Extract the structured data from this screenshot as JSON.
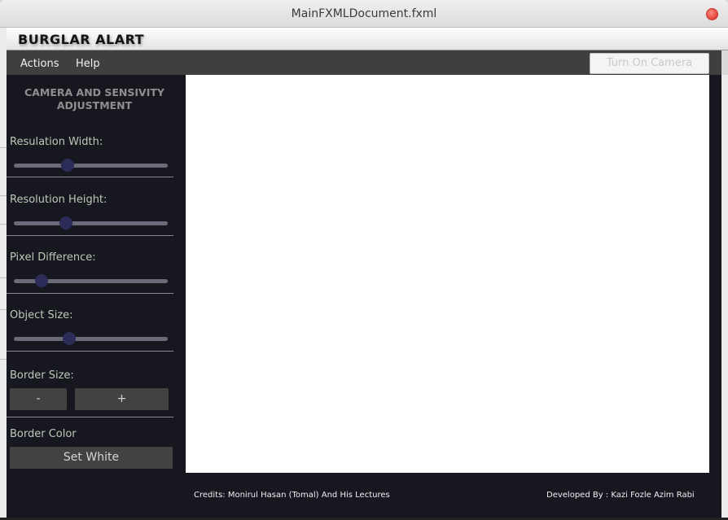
{
  "window": {
    "title": "MainFXMLDocument.fxml"
  },
  "app": {
    "title": "BURGLAR ALART"
  },
  "menu": {
    "items": [
      "Actions",
      "Help"
    ]
  },
  "toolbar": {
    "camera_button": "Turn On Camera"
  },
  "sidebar": {
    "heading_line1": "CAMERA AND SENSIVITY",
    "heading_line2": "ADJUSTMENT",
    "sliders": [
      {
        "label": "Resulation Width:",
        "value": 0.35
      },
      {
        "label": "Resolution Height:",
        "value": 0.34
      },
      {
        "label": "Pixel Difference:",
        "value": 0.18
      },
      {
        "label": "Object Size:",
        "value": 0.36
      }
    ],
    "border_size": {
      "label": "Border Size:",
      "minus": "-",
      "plus": "+"
    },
    "border_color": {
      "label": "Border Color",
      "button": "Set White"
    }
  },
  "footer": {
    "credits": "Credits: Monirul Hasan (Tomal) And His Lectures",
    "developer": "Developed By : Kazi Fozle Azim Rabi"
  },
  "colors": {
    "panel_bg": "#17171f",
    "menubar_bg": "#3f3f3f",
    "slider_thumb": "#2c2c58",
    "label_text": "#bfc9b8"
  }
}
